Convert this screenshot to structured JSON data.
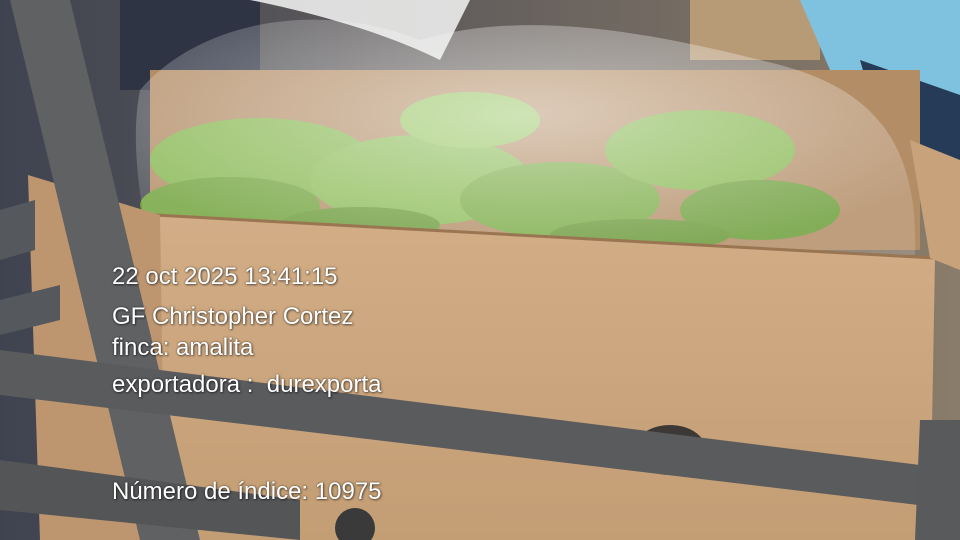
{
  "photo": {
    "subject": "cardboard box of green bananas wrapped in plastic on a metal cart",
    "colors": {
      "cardboard": "#c9a27a",
      "banana_green": "#7fb24a",
      "cart_metal": "#5e5f61",
      "plastic": "#eef2ee"
    }
  },
  "overlay": {
    "datetime": "22 oct 2025 13:41:15",
    "user": "GF Christopher Cortez",
    "finca": "finca: amalita",
    "exportadora": "exportadora :  durexporta",
    "indice": "Número de índice: 10975"
  }
}
